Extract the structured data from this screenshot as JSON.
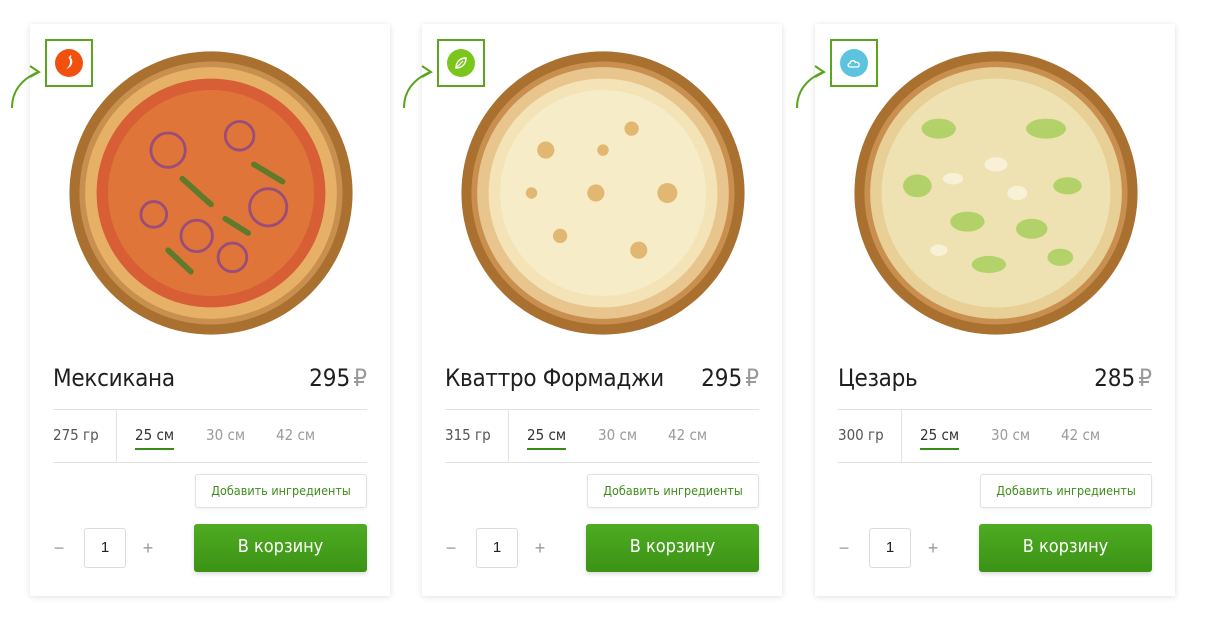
{
  "colors": {
    "accent_green": "#4eab22",
    "badge_spicy": "#f2500f",
    "badge_vegetarian": "#7ac61c",
    "badge_light": "#5ec3de"
  },
  "products": [
    {
      "name": "Мексикана",
      "price": "295",
      "currency": "₽",
      "weight": "275 гр",
      "sizes": [
        "25 см",
        "30 см",
        "42 см"
      ],
      "selected_size": "25 см",
      "badge_icon": "chili-pepper-icon",
      "add_ingredients_label": "Добавить ингредиенты",
      "quantity": "1",
      "minus_label": "−",
      "plus_label": "+",
      "cart_label": "В корзину"
    },
    {
      "name": "Кваттро Формаджи",
      "price": "295",
      "currency": "₽",
      "weight": "315 гр",
      "sizes": [
        "25 см",
        "30 см",
        "42 см"
      ],
      "selected_size": "25 см",
      "badge_icon": "leaf-icon",
      "add_ingredients_label": "Добавить ингредиенты",
      "quantity": "1",
      "minus_label": "−",
      "plus_label": "+",
      "cart_label": "В корзину"
    },
    {
      "name": "Цезарь",
      "price": "285",
      "currency": "₽",
      "weight": "300 гр",
      "sizes": [
        "25 см",
        "30 см",
        "42 см"
      ],
      "selected_size": "25 см",
      "badge_icon": "cloud-icon",
      "add_ingredients_label": "Добавить ингредиенты",
      "quantity": "1",
      "minus_label": "−",
      "plus_label": "+",
      "cart_label": "В корзину"
    }
  ]
}
